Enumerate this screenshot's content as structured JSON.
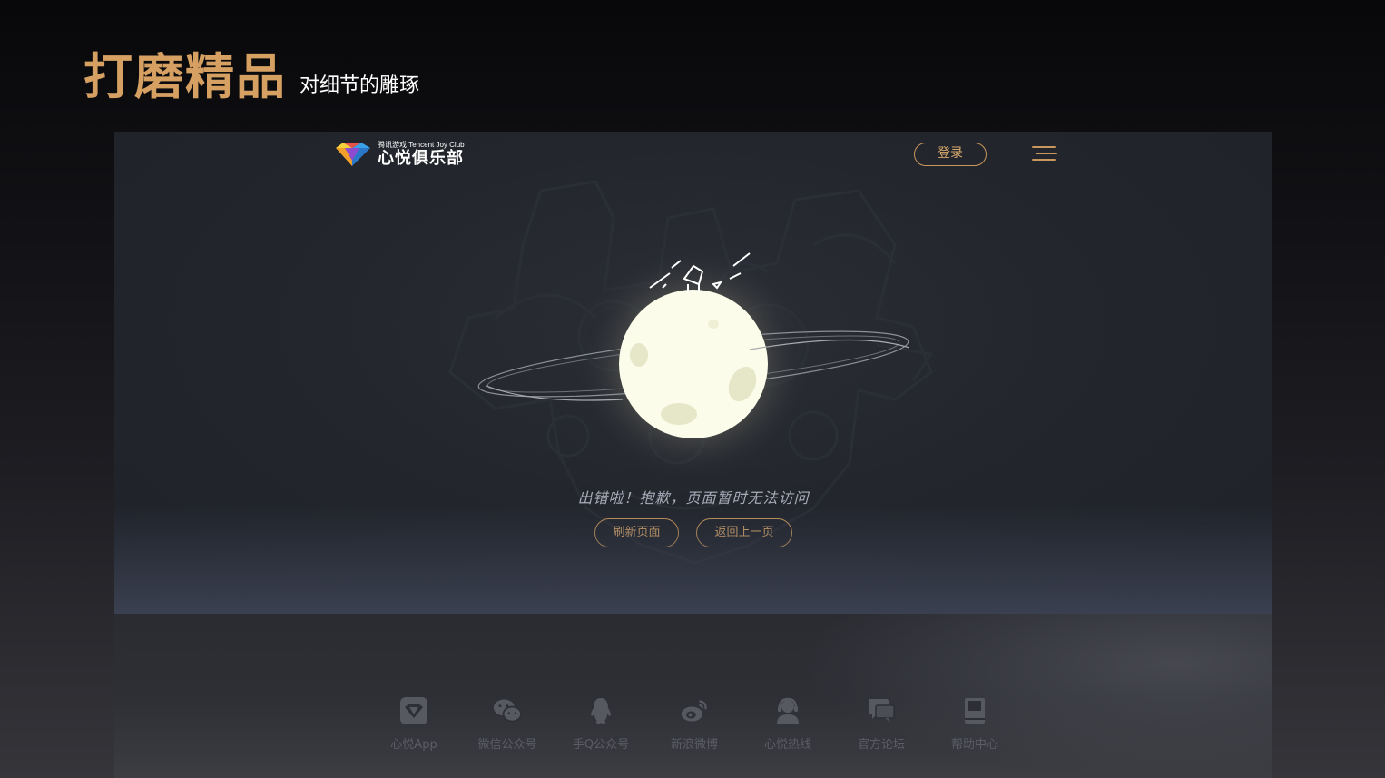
{
  "slide": {
    "title": "打磨精品",
    "subtitle": "对细节的雕琢"
  },
  "header": {
    "logo_sub": "腾讯游戏 Tencent Joy Club",
    "logo_main": "心悦俱乐部",
    "login_label": "登录",
    "menu_icon": "hamburger-menu-icon"
  },
  "error": {
    "message": "出错啦！抱歉，页面暂时无法访问",
    "refresh_label": "刷新页面",
    "back_label": "返回上一页"
  },
  "footer": {
    "links": [
      {
        "label": "心悦App",
        "icon": "app-icon"
      },
      {
        "label": "微信公众号",
        "icon": "wechat-icon"
      },
      {
        "label": "手Q公众号",
        "icon": "qq-icon"
      },
      {
        "label": "新浪微博",
        "icon": "weibo-icon"
      },
      {
        "label": "心悦热线",
        "icon": "hotline-icon"
      },
      {
        "label": "官方论坛",
        "icon": "forum-icon"
      },
      {
        "label": "帮助中心",
        "icon": "help-icon"
      }
    ]
  },
  "colors": {
    "accent": "#d6a063",
    "button_border": "#c9975b",
    "moon": "#fbfcea",
    "footer_text": "#5a5d64"
  }
}
